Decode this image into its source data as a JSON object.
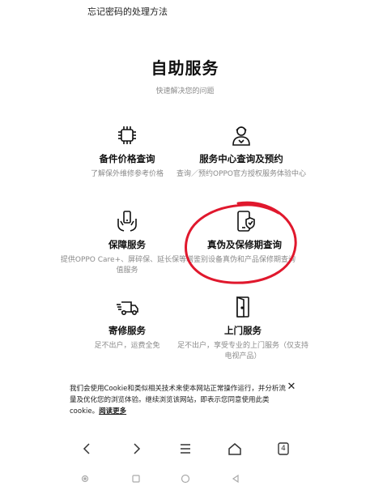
{
  "top_link": "忘记密码的处理方法",
  "page_title": "自助服务",
  "page_subtitle": "快速解决您的问题",
  "services": [
    {
      "name": "备件价格查询",
      "desc": "了解保外维修参考价格",
      "icon": "chip-icon"
    },
    {
      "name": "服务中心查询及预约",
      "desc": "查询／预约OPPO官方授权服务体验中心",
      "icon": "service-agent-icon"
    },
    {
      "name": "保障服务",
      "desc": "提供OPPO Care+、屏碎保、延长保等增值服务",
      "icon": "hands-phone-icon"
    },
    {
      "name": "真伪及保修期查询",
      "desc": "鉴别设备真伪和产品保修期查询",
      "icon": "phone-shield-icon"
    },
    {
      "name": "寄修服务",
      "desc": "足不出户，运费全免",
      "icon": "delivery-truck-icon"
    },
    {
      "name": "上门服务",
      "desc": "足不出户，享受专业的上门服务（仅支持电视产品）",
      "icon": "door-icon"
    }
  ],
  "cookie_notice": {
    "text": "我们会使用Cookie和类似相关技术来使本网站正常操作运行，并分析流量及优化您的浏览体验。继续浏览该网站，即表示您同意使用此类cookie。",
    "more_label": "阅读更多",
    "close_icon": "close-icon"
  },
  "browser_nav": {
    "tab_count": "4"
  },
  "annotation_color": "#e0182d"
}
